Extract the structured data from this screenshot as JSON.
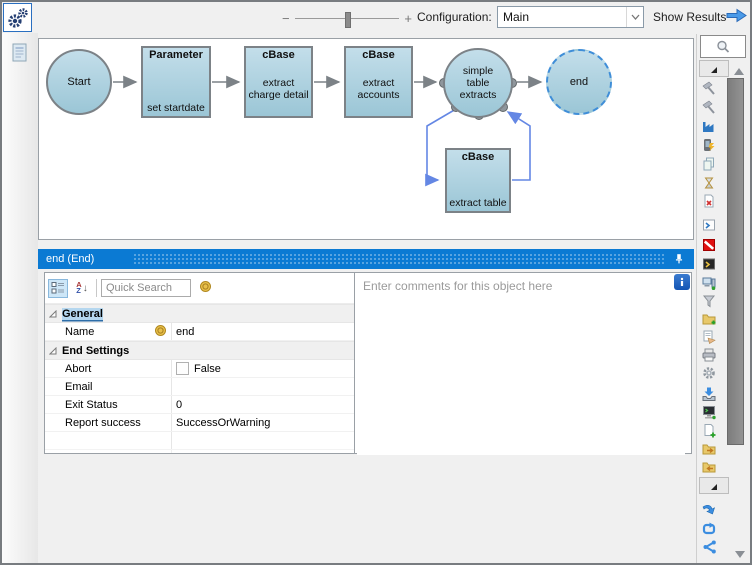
{
  "toolbar": {
    "zoom_minus": "−",
    "zoom_plus": "+",
    "configuration_label": "Configuration:",
    "configuration_value": "Main",
    "show_results_label": "Show Results"
  },
  "flow": {
    "nodes": [
      {
        "id": "start",
        "title": "Start"
      },
      {
        "id": "parameter",
        "title": "Parameter",
        "label": "set startdate"
      },
      {
        "id": "cbase-charge-detail",
        "title": "cBase",
        "label": "extract charge detail"
      },
      {
        "id": "cbase-accounts",
        "title": "cBase",
        "label": "extract accounts"
      },
      {
        "id": "simple-table-extracts",
        "title": "simple table extracts"
      },
      {
        "id": "end",
        "title": "end"
      },
      {
        "id": "cbase-extract-table",
        "title": "cBase",
        "label": "extract table"
      }
    ]
  },
  "panel": {
    "title": "end (End)"
  },
  "property_grid": {
    "search_placeholder": "Quick Search",
    "az_a": "A",
    "az_z": "Z",
    "az_arrow": "↓",
    "groups": [
      {
        "label": "General"
      },
      {
        "label": "End Settings"
      }
    ],
    "rows": [
      {
        "label": "Name",
        "value": "end"
      },
      {
        "label": "Abort",
        "value": "False"
      },
      {
        "label": "Email",
        "value": ""
      },
      {
        "label": "Exit Status",
        "value": "0"
      },
      {
        "label": "Report success",
        "value": "SuccessOrWarning"
      }
    ]
  },
  "comments": {
    "placeholder": "Enter comments for this object here"
  },
  "sidebar": {
    "icons": [
      "search",
      "collapse-group",
      "scroll-up",
      "hammer",
      "hammer-2",
      "factory",
      "device-lightning",
      "copy-pages",
      "hourglass",
      "file-delete",
      "console",
      "no-entry",
      "console-dark",
      "computer-network",
      "filter-funnel",
      "folder-add",
      "form-hand",
      "printer",
      "gear",
      "export-tray",
      "terminal-monitor",
      "file-add",
      "folder-out",
      "folder-in",
      "collapse-group-2",
      "flow-merge",
      "flow-loop",
      "flow-split",
      "scroll-down"
    ]
  },
  "colors": {
    "header_blue": "#0b7ad3",
    "node_fill": "#a9cfdd",
    "node_border": "#7c8287",
    "connector_blue": "#6487e4",
    "selection_dashed_blue": "#3f8ed8"
  }
}
